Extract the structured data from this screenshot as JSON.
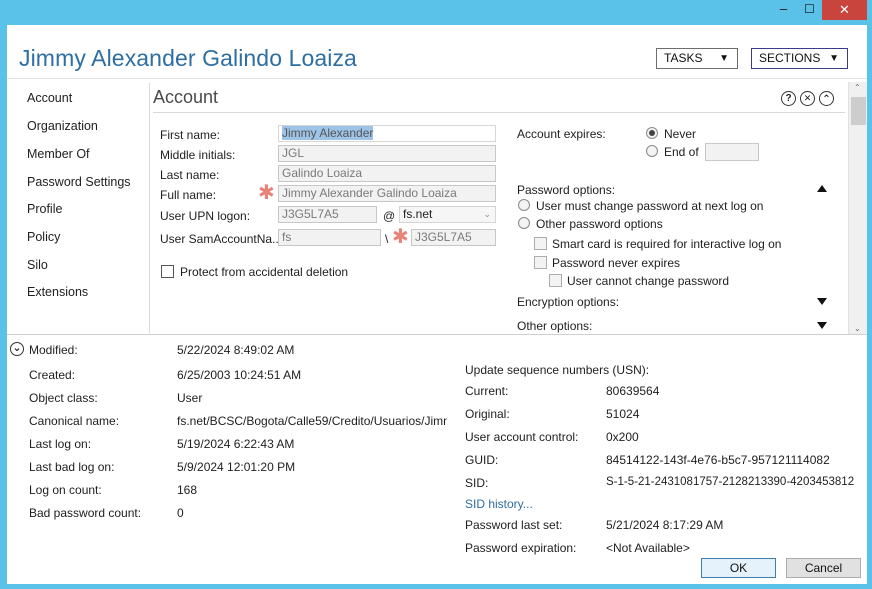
{
  "window": {
    "title": "Jimmy Alexander Galindo Loaiza",
    "minimize_glyph": "–",
    "maximize_glyph": "☐",
    "close_glyph": "✕"
  },
  "header": {
    "tasks_label": "TASKS",
    "sections_label": "SECTIONS",
    "dropdown_glyph": "▼"
  },
  "nav": {
    "items": [
      "Account",
      "Organization",
      "Member Of",
      "Password Settings",
      "Profile",
      "Policy",
      "Silo",
      "Extensions"
    ]
  },
  "panel": {
    "title": "Account",
    "help_glyph": "?",
    "close_glyph": "✕",
    "collapse_glyph": "⌃"
  },
  "account_form": {
    "first_name_label": "First name:",
    "first_name_value": "Jimmy Alexander",
    "middle_initials_label": "Middle initials:",
    "middle_initials_value": "JGL",
    "last_name_label": "Last name:",
    "last_name_value": "Galindo Loaiza",
    "full_name_label": "Full name:",
    "full_name_value": "Jimmy Alexander Galindo Loaiza",
    "upn_label": "User UPN logon:",
    "upn_value": "J3G5L7A5",
    "upn_at": "@",
    "upn_domain": "fs.net",
    "sam_label": "User SamAccountNa...",
    "sam_domain": "fs",
    "sam_sep": "\\",
    "sam_value": "J3G5L7A5",
    "protect_label": "Protect from accidental deletion",
    "required_glyph": "✱"
  },
  "account_options": {
    "expires_label": "Account expires:",
    "never_label": "Never",
    "end_of_label": "End of",
    "password_options_label": "Password options:",
    "must_change_label": "User must change password at next log on",
    "other_pw_options_label": "Other password options",
    "smart_card_label": "Smart card is required for interactive log on",
    "never_expires_label": "Password never expires",
    "cannot_change_label": "User cannot change password",
    "encryption_label": "Encryption options:",
    "other_options_label": "Other options:"
  },
  "details": {
    "expand_glyph": "⌄",
    "modified_label": "Modified:",
    "modified_value": "5/22/2024 8:49:02 AM",
    "created_label": "Created:",
    "created_value": "6/25/2003 10:24:51 AM",
    "object_class_label": "Object class:",
    "object_class_value": "User",
    "canonical_label": "Canonical name:",
    "canonical_value": "fs.net/BCSC/Bogota/Calle59/Credito/Usuarios/Jimn",
    "last_logon_label": "Last log on:",
    "last_logon_value": "5/19/2024 6:22:43 AM",
    "last_bad_logon_label": "Last bad log on:",
    "last_bad_logon_value": "5/9/2024 12:01:20 PM",
    "logon_count_label": "Log on count:",
    "logon_count_value": "168",
    "bad_pw_count_label": "Bad password count:",
    "bad_pw_count_value": "0",
    "usn_label": "Update sequence numbers (USN):",
    "current_label": "Current:",
    "current_value": "80639564",
    "original_label": "Original:",
    "original_value": "51024",
    "uac_label": "User account control:",
    "uac_value": "0x200",
    "guid_label": "GUID:",
    "guid_value": "84514122-143f-4e76-b5c7-957121114082",
    "sid_label": "SID:",
    "sid_value": "S-1-5-21-2431081757-2128213390-4203453812",
    "sid_history_label": "SID history...",
    "pw_last_set_label": "Password last set:",
    "pw_last_set_value": "5/21/2024 8:17:29 AM",
    "pw_expiration_label": "Password expiration:",
    "pw_expiration_value": "<Not Available>"
  },
  "footer": {
    "ok_label": "OK",
    "cancel_label": "Cancel"
  },
  "colors": {
    "frame": "#5ac1e8",
    "title_blue": "#2d6ea3",
    "link_blue": "#2d6ea3",
    "required_star": "#e8837a",
    "close_red": "#c9443c"
  }
}
